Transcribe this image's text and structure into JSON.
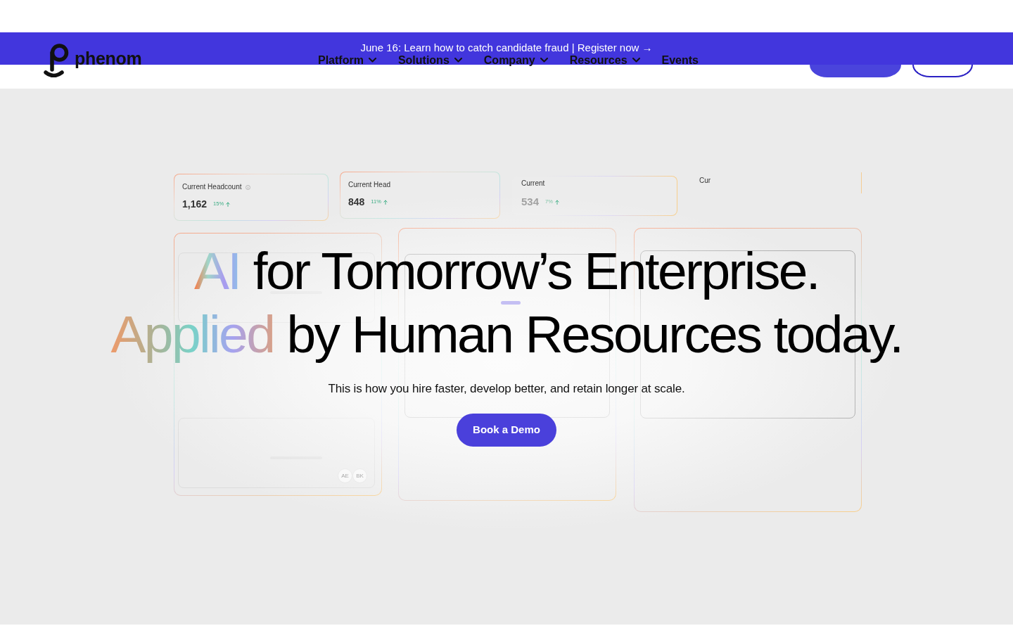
{
  "banner": {
    "text": "June 16: Learn how to catch candidate fraud | Register now →"
  },
  "logo": {
    "wordmark": "phenom"
  },
  "nav": [
    {
      "label": "Platform",
      "dropdown": true
    },
    {
      "label": "Solutions",
      "dropdown": true
    },
    {
      "label": "Company",
      "dropdown": true
    },
    {
      "label": "Resources",
      "dropdown": true
    },
    {
      "label": "Events",
      "dropdown": false
    }
  ],
  "header_buttons": [
    {
      "kind": "filled"
    },
    {
      "kind": "outline"
    }
  ],
  "metric_cards": [
    {
      "label": "Current Headcount",
      "info_icon": true,
      "value": "1,162",
      "change": "15%"
    },
    {
      "label": "Current Head",
      "info_icon": false,
      "value": "848",
      "change": "11%"
    },
    {
      "label": "Current",
      "info_icon": false,
      "value": "534",
      "change": "7%"
    },
    {
      "label": "Cur",
      "info_icon": false
    }
  ],
  "panel_cards": [
    {
      "panels": [
        {
          "kind": "bar"
        },
        {
          "kind": "bar",
          "avatars": [
            "AE",
            "BK"
          ]
        }
      ]
    },
    {
      "panels": [
        {
          "kind": "accent"
        }
      ]
    },
    {
      "panels": [
        {
          "kind": "empty"
        }
      ]
    }
  ],
  "hero": {
    "headline": [
      [
        {
          "text": "AI",
          "kind": "gradient"
        },
        {
          "text": "for Tomorrow’s Enterprise.",
          "kind": "plain"
        }
      ],
      [
        {
          "text": "Applied",
          "kind": "gradient"
        },
        {
          "text": "by Human Resources today.",
          "kind": "plain"
        }
      ]
    ],
    "subtitle": "This is how you hire faster, develop better, and retain longer at scale.",
    "button": "Book a Demo"
  }
}
